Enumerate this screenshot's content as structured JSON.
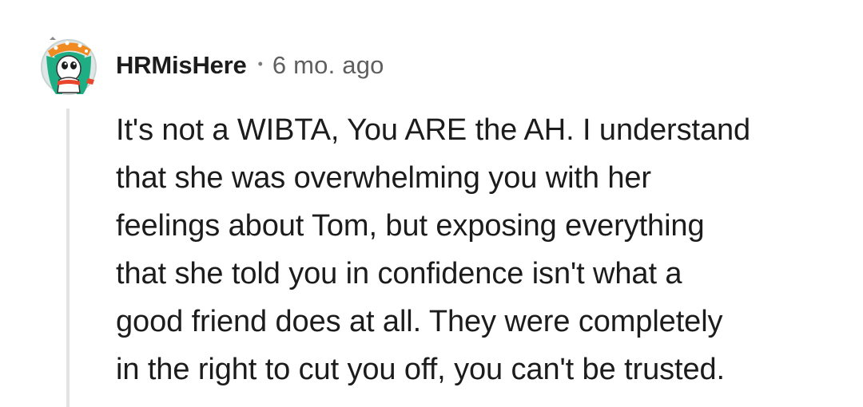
{
  "comment": {
    "username": "HRMisHere",
    "separator": "•",
    "timestamp": "6 mo. ago",
    "avatar_icon": "snoo-avatar-icon",
    "body_lines": [
      "It's not a WIBTA, You ARE the AH. I understand",
      "that she was overwhelming you with her",
      "feelings about Tom, but exposing everything",
      "that she told you in confidence isn't what a",
      "good friend does at all. They were completely",
      "in the right to cut you off, you can't be trusted."
    ]
  },
  "colors": {
    "background": "#ffffff",
    "text": "#1c1c1c",
    "meta": "#5f5f5f",
    "thread_line": "#e3e3e3"
  }
}
